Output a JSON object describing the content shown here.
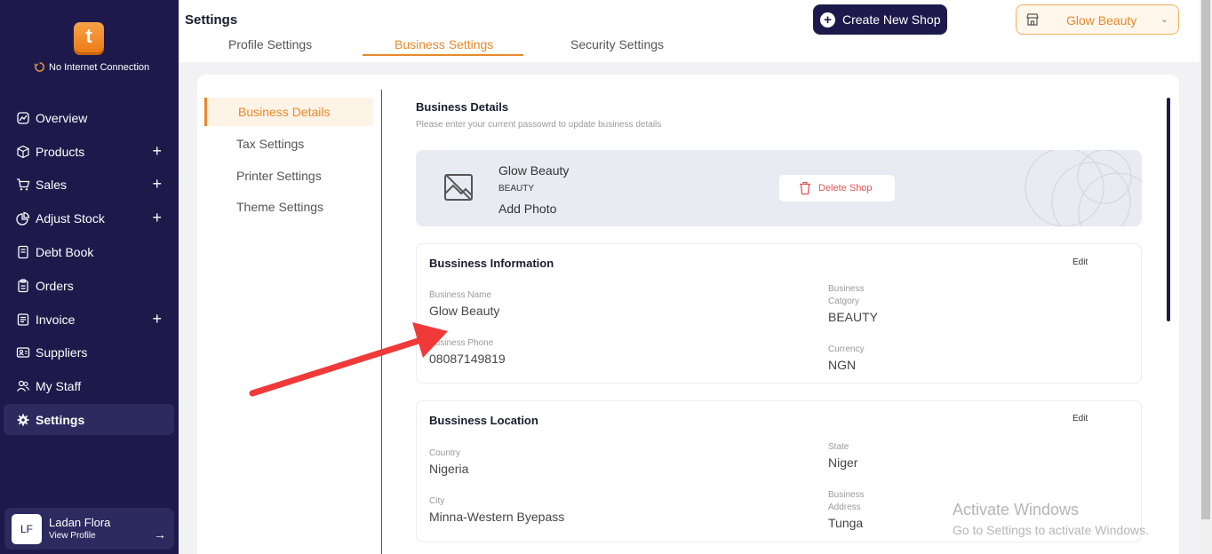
{
  "sidebar": {
    "logo_letter": "t",
    "net_status": "No Internet Connection",
    "items": [
      {
        "label": "Overview",
        "icon": "chart-icon",
        "plus": ""
      },
      {
        "label": "Products",
        "icon": "box-icon",
        "plus": "+"
      },
      {
        "label": "Sales",
        "icon": "cart-icon",
        "plus": "+"
      },
      {
        "label": "Adjust Stock",
        "icon": "pie-icon",
        "plus": "+"
      },
      {
        "label": "Debt Book",
        "icon": "book-icon",
        "plus": ""
      },
      {
        "label": "Orders",
        "icon": "clipboard-icon",
        "plus": ""
      },
      {
        "label": "Invoice",
        "icon": "invoice-icon",
        "plus": "+"
      },
      {
        "label": "Suppliers",
        "icon": "contacts-icon",
        "plus": ""
      },
      {
        "label": "My Staff",
        "icon": "users-icon",
        "plus": ""
      },
      {
        "label": "Settings",
        "icon": "gear-icon",
        "plus": ""
      }
    ],
    "profile": {
      "initials": "LF",
      "name": "Ladan Flora",
      "link": "View Profile",
      "arrow": "→"
    }
  },
  "header": {
    "title": "Settings",
    "tabs": [
      "Profile Settings",
      "Business Settings",
      "Security Settings"
    ],
    "active_tab": "Business Settings",
    "create_label": "Create New Shop",
    "shop_select": "Glow Beauty"
  },
  "settings_menu": [
    "Business Details",
    "Tax Settings",
    "Printer Settings",
    "Theme Settings"
  ],
  "business_details": {
    "title": "Business Details",
    "subtitle": "Please enter your current passowrd to update business details",
    "banner": {
      "name": "Glow Beauty",
      "category": "BEAUTY",
      "add_photo": "Add Photo",
      "delete_label": "Delete Shop"
    },
    "information": {
      "title": "Bussiness Information",
      "edit": "Edit",
      "business_name_label": "Business Name",
      "business_name": "Glow Beauty",
      "category_label_1": "Business",
      "category_label_2": "Catgory",
      "category": "BEAUTY",
      "phone_label": "Business Phone",
      "phone": "08087149819",
      "currency_label": "Currency",
      "currency": "NGN"
    },
    "location": {
      "title": "Bussiness Location",
      "edit": "Edit",
      "country_label": "Country",
      "country": "Nigeria",
      "state_label": "State",
      "state": "Niger",
      "city_label": "City",
      "city": "Minna-Western Byepass",
      "address_label_1": "Business",
      "address_label_2": "Address",
      "address": "Tunga"
    }
  },
  "watermark": {
    "line1": "Activate Windows",
    "line2": "Go to Settings to activate Windows."
  },
  "colors": {
    "sidebar_bg": "#1d1a4b",
    "accent": "#e8892a",
    "danger": "#e25555",
    "annotation_arrow": "#f03a3a"
  }
}
